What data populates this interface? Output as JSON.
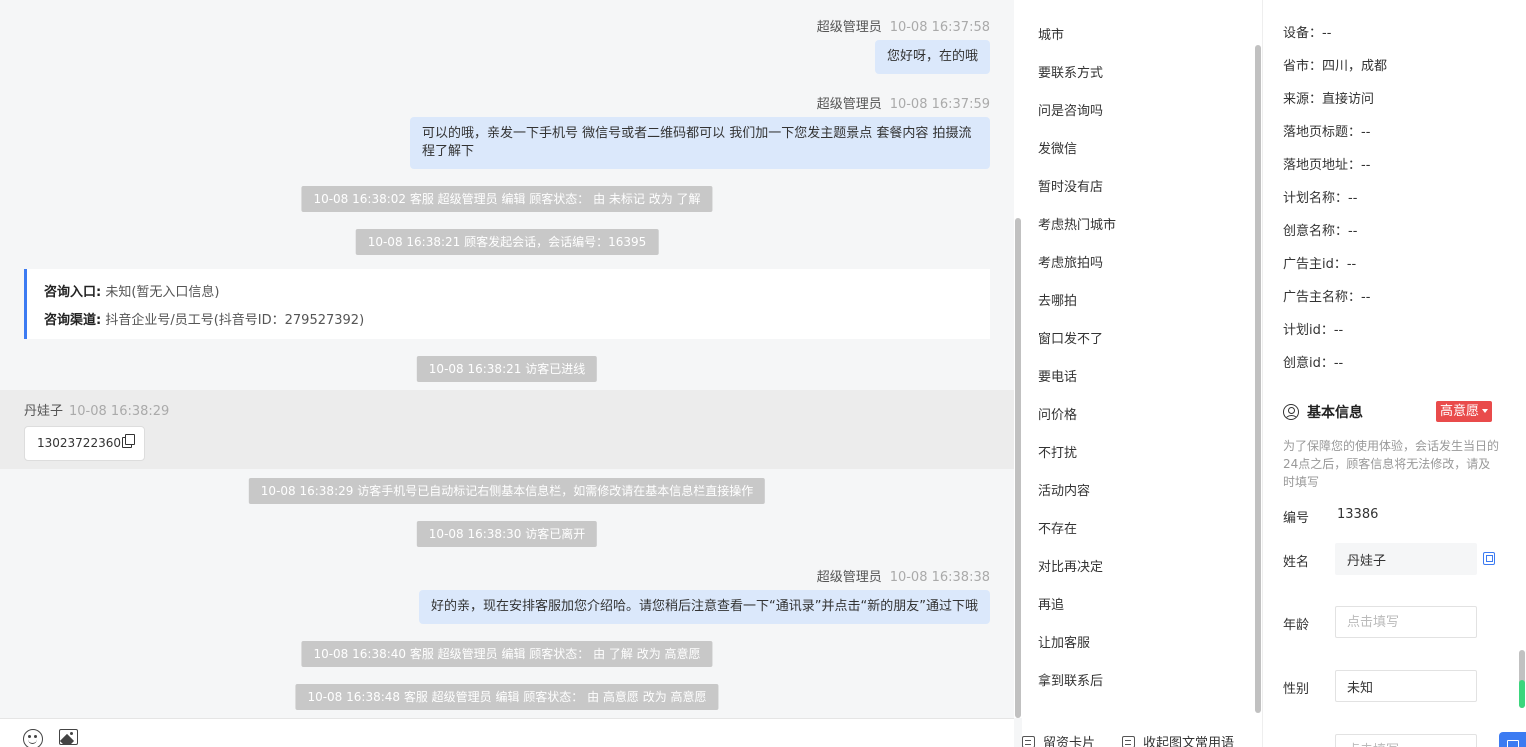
{
  "chat": {
    "messages": [
      {
        "sender": "超级管理员",
        "time": "10-08 16:37:58",
        "text": "您好呀，在的哦"
      },
      {
        "sender": "超级管理员",
        "time": "10-08 16:37:59",
        "text_line1": "可以的哦，亲发一下手机号 微信号或者二维码都可以 我们加一下您发主题景点 套餐内容 拍摄流",
        "text_line2": "程了解下"
      },
      {
        "sender": "超级管理员",
        "time": "10-08 16:38:38",
        "text": "好的亲，现在安排客服加您介绍哈。请您稍后注意查看一下“通讯录”并点击“新的朋友”通过下哦"
      }
    ],
    "system_notices": [
      "10-08 16:38:02 客服 超级管理员 编辑 顾客状态： 由 未标记 改为 了解",
      "10-08 16:38:21 顾客发起会话，会话编号：16395",
      "10-08 16:38:21 访客已进线",
      "10-08 16:38:29 访客手机号已自动标记右侧基本信息栏，如需修改请在基本信息栏直接操作",
      "10-08 16:38:30 访客已离开",
      "10-08 16:38:40 客服 超级管理员 编辑 顾客状态： 由 了解 改为 高意愿",
      "10-08 16:38:48 客服 超级管理员 编辑 顾客状态： 由 高意愿 改为 高意愿"
    ],
    "entry_card": {
      "entry_label": "咨询入口:",
      "entry_value": "未知(暂无入口信息)",
      "channel_label": "咨询渠道:",
      "channel_value": "抖音企业号/员工号(抖音号ID：279527392)"
    },
    "visitor_message": {
      "sender": "丹娃子",
      "time": "10-08 16:38:29",
      "text": "13023722360"
    }
  },
  "toolbar": {
    "icons": [
      "emoji-icon",
      "image-icon"
    ]
  },
  "quick_replies": {
    "items": [
      "城市",
      "要联系方式",
      "问是咨询吗",
      "发微信",
      "暂时没有店",
      "考虑热门城市",
      "考虑旅拍吗",
      "去哪拍",
      "窗口发不了",
      "要电话",
      "问价格",
      "不打扰",
      "活动内容",
      "不存在",
      "对比再决定",
      "再追",
      "让加客服",
      "拿到联系后"
    ],
    "footer_left": "留资卡片",
    "footer_right": "收起图文常用语"
  },
  "info": {
    "rows": [
      "设备：--",
      "省市：四川，成都",
      "来源：直接访问",
      "落地页标题：--",
      "落地页地址：--",
      "计划名称：--",
      "创意名称：--",
      "广告主id：--",
      "广告主名称：--",
      "计划id：--",
      "创意id：--"
    ],
    "basic_title": "基本信息",
    "intent_badge": "高意愿",
    "notice": "为了保障您的使用体验，会话发生当日的24点之后，顾客信息将无法修改，请及时填写",
    "id_label": "编号",
    "id_value": "13386",
    "name_label": "姓名",
    "name_value": "丹娃子",
    "age_label": "年龄",
    "age_placeholder": "点击填写",
    "gender_label": "性别",
    "gender_value": "未知",
    "accent_color": "#3c7bf2",
    "badge_color": "#e94b4b"
  }
}
